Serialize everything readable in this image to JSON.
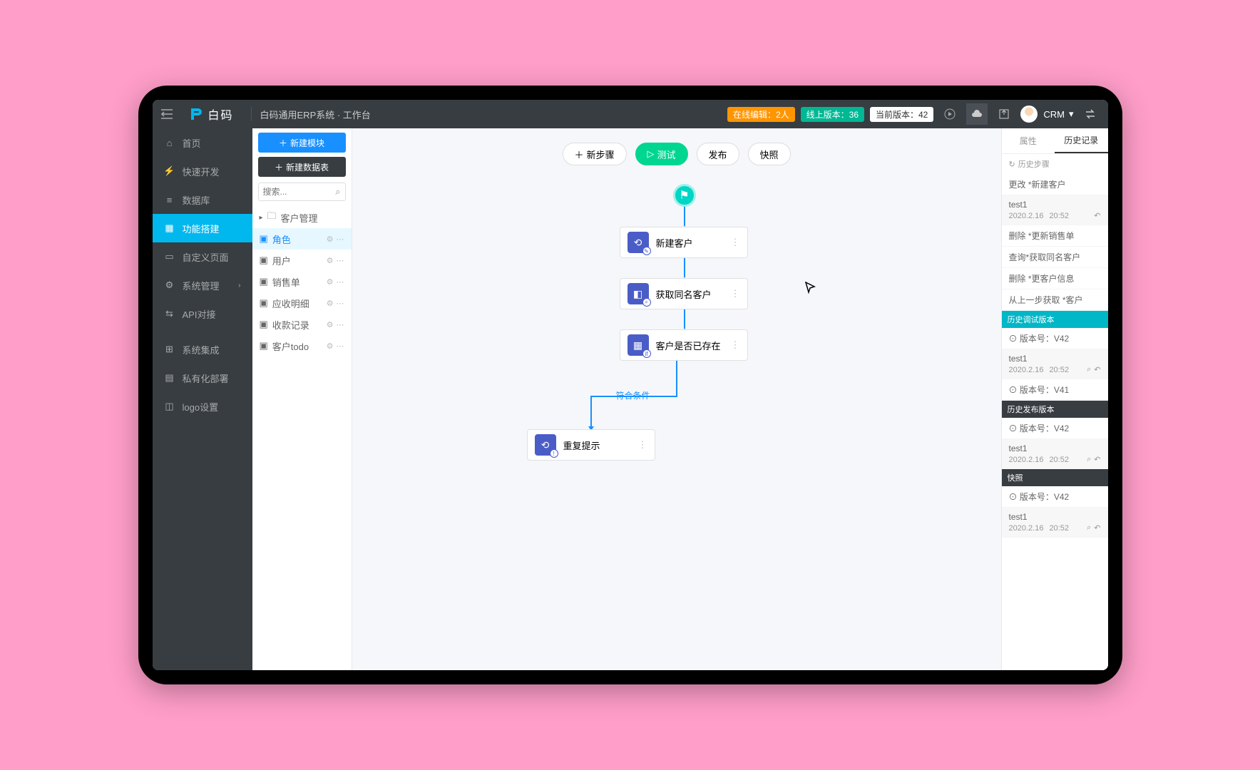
{
  "app": {
    "logo_text": "白码",
    "breadcrumb": "白码通用ERP系统 · 工作台"
  },
  "topbar": {
    "badges": {
      "editing": "在线编辑：2人",
      "online": "线上版本：36",
      "current": "当前版本：42"
    },
    "user": "CRM"
  },
  "sidebar": {
    "items": [
      "首页",
      "快速开发",
      "数据库",
      "功能搭建",
      "自定义页面",
      "系统管理",
      "API对接",
      "系统集成",
      "私有化部署",
      "logo设置"
    ],
    "active_index": 3
  },
  "panel2": {
    "btn_new_module": "新建模块",
    "btn_new_table": "新建数据表",
    "search_placeholder": "搜索...",
    "folder": "客户管理",
    "items": [
      "角色",
      "用户",
      "销售单",
      "应收明细",
      "收款记录",
      "客户todo"
    ],
    "selected_index": 0
  },
  "canvas": {
    "toolbar": {
      "new_step": "新步骤",
      "test": "测试",
      "publish": "发布",
      "snapshot": "快照"
    },
    "nodes": {
      "n1": "新建客户",
      "n2": "获取同名客户",
      "n3": "客户是否已存在",
      "n4": "重复提示"
    },
    "condition_label": "符合条件"
  },
  "rpanel": {
    "tabs": {
      "attr": "属性",
      "history": "历史记录"
    },
    "history_title": "历史步骤",
    "history_steps": [
      "更改 *新建客户"
    ],
    "test1": {
      "name": "test1",
      "date": "2020.2.16",
      "time": "20:52"
    },
    "history_ops": [
      "删除 *更新销售单",
      "查询*获取同名客户",
      "删除 *更客户信息",
      "从上一步获取 *客户"
    ],
    "sections": {
      "debug": {
        "title": "历史调试版本",
        "version_label": "版本号：",
        "v1": "V42",
        "v2": "V41"
      },
      "publish": {
        "title": "历史发布版本",
        "v": "V42"
      },
      "snap": {
        "title": "快照",
        "v": "V42"
      }
    }
  }
}
